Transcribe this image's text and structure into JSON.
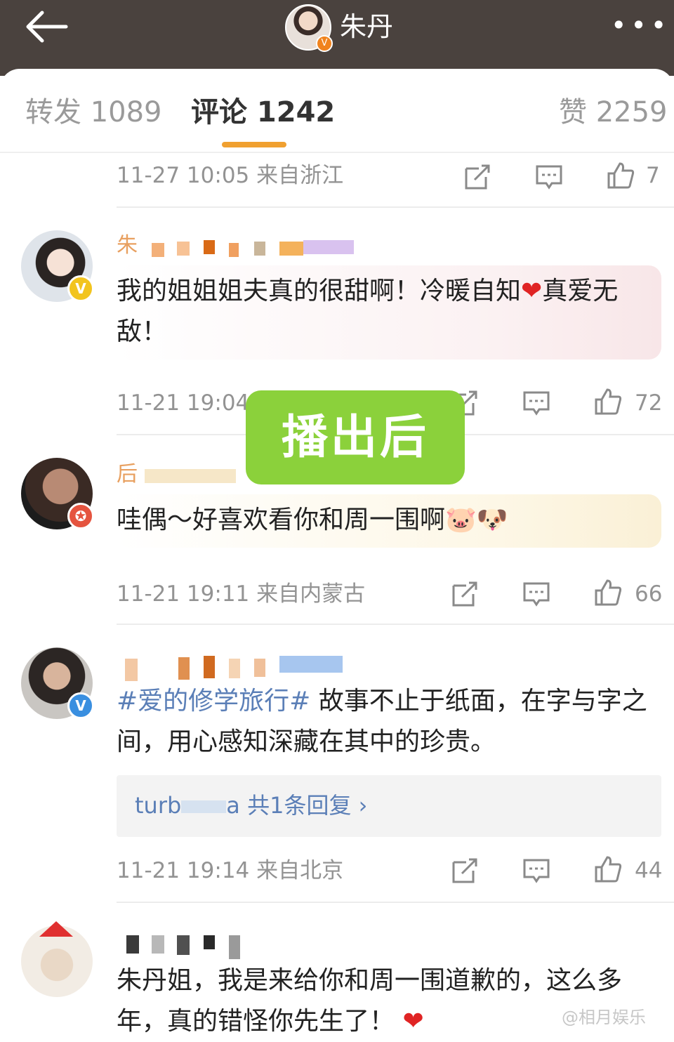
{
  "header": {
    "back_icon": "arrow-left-icon",
    "title": "朱丹",
    "verified_badge": "V",
    "more_icon": "more-horizontal-icon",
    "more_label": "•••"
  },
  "tabs": [
    {
      "label": "转发 1089"
    },
    {
      "label": "评论 1242"
    },
    {
      "label": "赞 2259"
    }
  ],
  "top_meta": {
    "time_location": "11-27 10:05  来自浙江",
    "likes": "7"
  },
  "comments": [
    {
      "user": "朱",
      "badge": "V",
      "text_a": "我的姐姐姐夫真的很甜啊！冷暖自知",
      "heart": "❤",
      "text_b": "真爱无敌！",
      "time": "11-21 19:04",
      "likes": "72"
    },
    {
      "user": "后",
      "badge": "✪",
      "text": "哇偶～好喜欢看你和周一围啊🐷🐶",
      "time": "11-21 19:11  来自内蒙古",
      "likes": "66"
    },
    {
      "hashtag": "#爱的修学旅行#",
      "text": " 故事不止于纸面，在字与字之间，用心感知深藏在其中的珍贵。",
      "badge": "V",
      "reply": "turb",
      "reply_tail": "a  共1条回复  ›",
      "time": "11-21 19:14  来自北京",
      "likes": "44"
    },
    {
      "text": "朱丹姐，我是来给你和周一围道歉的，这么多年，真的错怪你先生了！",
      "heart": "❤"
    }
  ],
  "overlay_label": "播出后",
  "watermark": "@相月娱乐",
  "colors": {
    "topbar": "#4a423e",
    "tab_underline": "#f0a030",
    "overlay": "#8bd13b",
    "hashtag": "#5b7fb7"
  }
}
